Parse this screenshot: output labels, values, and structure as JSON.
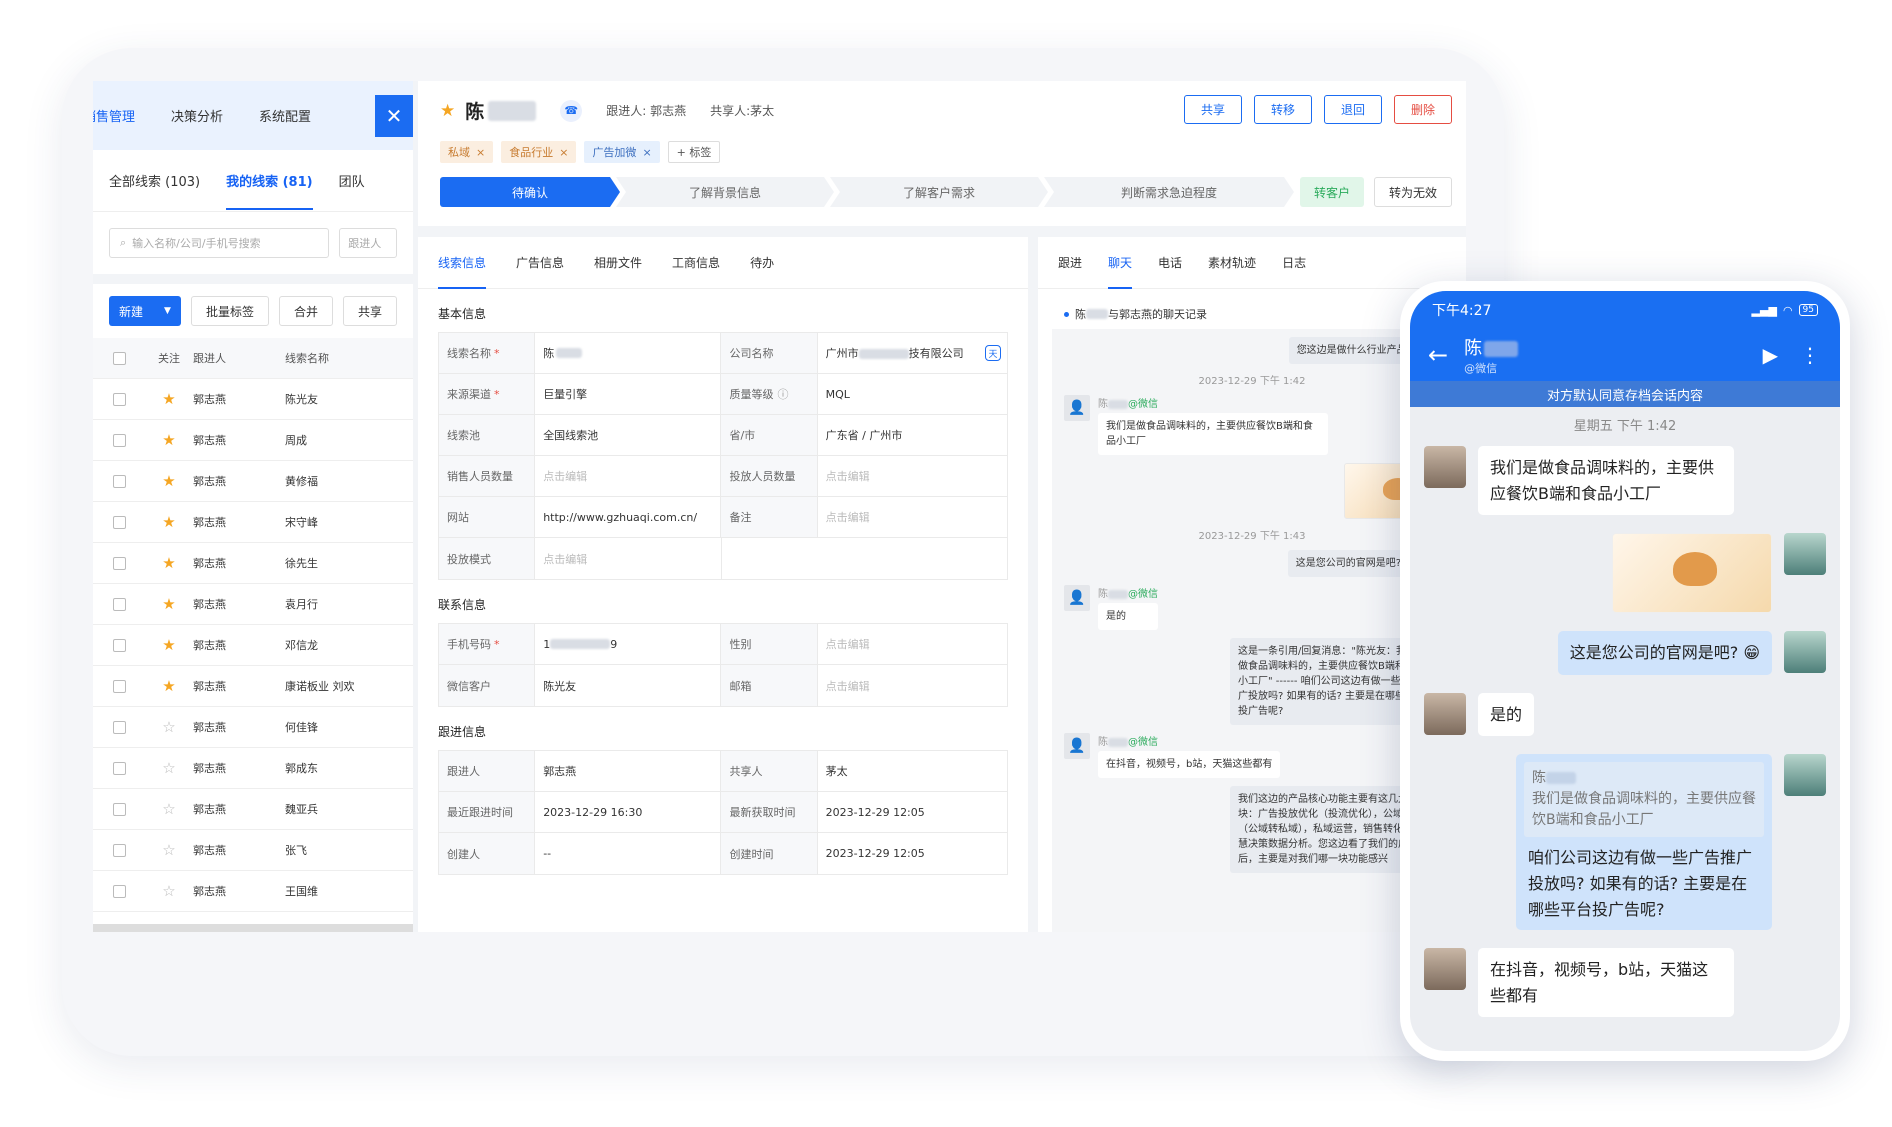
{
  "top_nav": [
    "销售管理",
    "决策分析",
    "系统配置"
  ],
  "list": {
    "tabs": [
      "全部线索 (103)",
      "我的线索 (81)",
      "团队"
    ],
    "search_placeholder": "输入名称/公司/手机号搜索",
    "follow_filter": "跟进人",
    "btn_new": "新建",
    "btn_batch_tag": "批量标签",
    "btn_merge": "合并",
    "btn_share": "共享",
    "columns": [
      "关注",
      "跟进人",
      "线索名称"
    ],
    "rows": [
      {
        "owner": "郭志燕",
        "name": "陈光友"
      },
      {
        "owner": "郭志燕",
        "name": "周成"
      },
      {
        "owner": "郭志燕",
        "name": "黄修福"
      },
      {
        "owner": "郭志燕",
        "name": "宋守峰"
      },
      {
        "owner": "郭志燕",
        "name": "徐先生"
      },
      {
        "owner": "郭志燕",
        "name": "袁月行"
      },
      {
        "owner": "郭志燕",
        "name": "邓信龙"
      },
      {
        "owner": "郭志燕",
        "name": "康诺板业 刘欢"
      },
      {
        "owner": "郭志燕",
        "name": "何佳锋"
      },
      {
        "owner": "郭志燕",
        "name": "郭成东"
      },
      {
        "owner": "郭志燕",
        "name": "魏亚兵"
      },
      {
        "owner": "郭志燕",
        "name": "张飞"
      },
      {
        "owner": "郭志燕",
        "name": "王国维"
      }
    ]
  },
  "detail": {
    "name": "陈",
    "follower": "跟进人: 郭志燕",
    "sharer": "共享人:茅太",
    "buttons": {
      "share": "共享",
      "transfer": "转移",
      "return": "退回",
      "delete": "删除"
    },
    "tags": [
      "私域",
      "食品行业",
      "广告加微"
    ],
    "add_tag": "+ 标签",
    "stages": [
      "待确认",
      "了解背景信息",
      "了解客户需求",
      "判断需求急迫程度"
    ],
    "to_customer": "转客户",
    "to_invalid": "转为无效",
    "info_tabs": [
      "线索信息",
      "广告信息",
      "相册文件",
      "工商信息",
      "待办"
    ],
    "basic_title": "基本信息",
    "basic": {
      "lead_name_lbl": "线索名称",
      "lead_name": "陈",
      "company_lbl": "公司名称",
      "company": "广州市",
      "company_suffix": "技有限公司",
      "source_lbl": "来源渠道",
      "source": "巨量引擎",
      "quality_lbl": "质量等级",
      "quality": "MQL",
      "pool_lbl": "线索池",
      "pool": "全国线索池",
      "region_lbl": "省/市",
      "region": "广东省 / 广州市",
      "sales_lbl": "销售人员数量",
      "placeholder": "点击编辑",
      "invest_lbl": "投放人员数量",
      "site_lbl": "网站",
      "site": "http://www.gzhuaqi.com.cn/",
      "note_lbl": "备注",
      "mode_lbl": "投放模式"
    },
    "contact_title": "联系信息",
    "contact": {
      "mobile_lbl": "手机号码",
      "mobile_pre": "1",
      "mobile_post": "9",
      "gender_lbl": "性别",
      "wx_lbl": "微信客户",
      "wx": "陈光友",
      "email_lbl": "邮箱"
    },
    "follow_title": "跟进信息",
    "follow": {
      "owner_lbl": "跟进人",
      "owner": "郭志燕",
      "sharer_lbl": "共享人",
      "sharer": "茅太",
      "last_follow_lbl": "最近跟进时间",
      "last_follow": "2023-12-29 16:30",
      "last_get_lbl": "最新获取时间",
      "last_get": "2023-12-29 12:05",
      "creator_lbl": "创建人",
      "creator": "--",
      "created_lbl": "创建时间",
      "created": "2023-12-29 12:05"
    }
  },
  "chat": {
    "tabs": [
      "跟进",
      "聊天",
      "电话",
      "素材轨迹",
      "日志"
    ],
    "header_pre": "陈",
    "header_post": "与郭志燕的聊天记录",
    "wx_tag": "@微信",
    "sender_pre": "陈",
    "msg1": "您这边是做什么行业产品的呀?",
    "ts1": "2023-12-29 下午 1:42",
    "msg2": "我们是做食品调味料的，主要供应餐饮B端和食品小工厂",
    "ts2": "2023-12-29 下午 1:43",
    "msg3": "这是您公司的官网是吧? [呲牙]",
    "msg4": "是的",
    "msg5": "这是一条引用/回复消息：\"陈光友：我们是做食品调味料的，主要供应餐饮B端和食品小工厂\" ------ 咱们公司这边有做一些广告推广投放吗? 如果有的话? 主要是在哪些平台投广告呢?",
    "msg6": "在抖音，视频号，b站，天猫这些都有",
    "msg7": "我们这边的产品核心功能主要有这几大板块：广告投放优化（投流优化），公域加微（公域转私域），私域运营，销售转化，智慧决策数据分析。您这边看了我们的广告之后，主要是对我们哪一块功能感兴"
  },
  "phone": {
    "time": "下午4:27",
    "battery": "95",
    "contact_name": "陈",
    "contact_sub": "@微信",
    "notice": "对方默认同意存档会话内容",
    "timestamp": "星期五  下午 1:42",
    "m1": "我们是做食品调味料的，主要供应餐饮B端和食品小工厂",
    "m2": "这是您公司的官网是吧?",
    "m3": "是的",
    "quote_name": "陈",
    "quote_text": "我们是做食品调味料的，主要供应餐饮B端和食品小工厂",
    "m4": "咱们公司这边有做一些广告推广投放吗? 如果有的话? 主要是在哪些平台投广告呢?",
    "m5": "在抖音，视频号，b站，天猫这些都有"
  }
}
